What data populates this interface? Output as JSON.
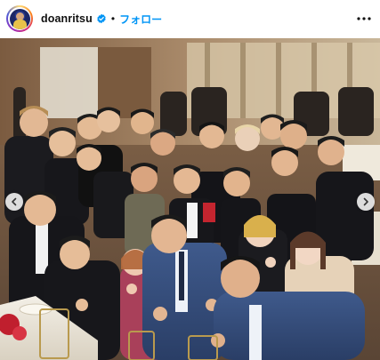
{
  "header": {
    "username": "doanritsu",
    "separator": "•",
    "follow_label": "フォロー"
  },
  "icons": {
    "avatar": "profile-avatar",
    "verified": "verified-badge-icon",
    "more": "more-options-icon",
    "prev": "chevron-left-icon",
    "next": "chevron-right-icon"
  },
  "colors": {
    "follow": "#0095f6",
    "verified": "#0095f6"
  }
}
